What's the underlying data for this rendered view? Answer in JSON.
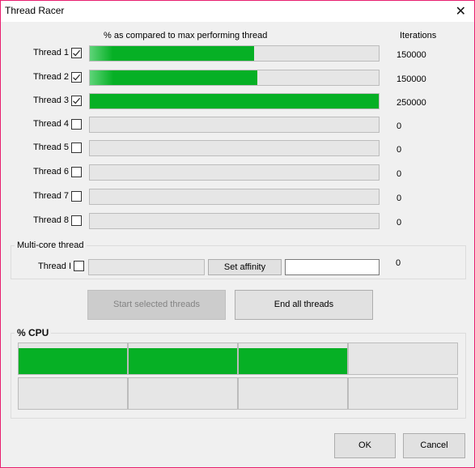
{
  "window": {
    "title": "Thread Racer",
    "close_icon": "close-x-icon"
  },
  "header": {
    "progress_label": "% as compared to max performing thread",
    "iterations_label": "Iterations"
  },
  "threads": [
    {
      "label": "Thread 1",
      "checked": true,
      "progress_percent": 57,
      "iterations": "150000"
    },
    {
      "label": "Thread 2",
      "checked": true,
      "progress_percent": 58,
      "iterations": "150000"
    },
    {
      "label": "Thread 3",
      "checked": true,
      "progress_percent": 100,
      "iterations": "250000"
    },
    {
      "label": "Thread 4",
      "checked": false,
      "progress_percent": 0,
      "iterations": "0"
    },
    {
      "label": "Thread 5",
      "checked": false,
      "progress_percent": 0,
      "iterations": "0"
    },
    {
      "label": "Thread 6",
      "checked": false,
      "progress_percent": 0,
      "iterations": "0"
    },
    {
      "label": "Thread 7",
      "checked": false,
      "progress_percent": 0,
      "iterations": "0"
    },
    {
      "label": "Thread 8",
      "checked": false,
      "progress_percent": 0,
      "iterations": "0"
    }
  ],
  "multicore": {
    "group_title": "Multi-core thread",
    "label": "Thread I",
    "checked": false,
    "progress_percent": 0,
    "set_affinity_label": "Set affinity",
    "affinity_value": "",
    "iterations": "0"
  },
  "actions": {
    "start_label": "Start selected threads",
    "start_enabled": false,
    "end_label": "End all threads"
  },
  "cpu": {
    "group_title": "% CPU",
    "cores_percent": [
      85,
      85,
      85,
      0,
      0,
      0,
      0,
      0
    ]
  },
  "footer": {
    "ok_label": "OK",
    "cancel_label": "Cancel"
  },
  "colors": {
    "progress_green": "#06b025",
    "window_border": "#e81e6f"
  }
}
